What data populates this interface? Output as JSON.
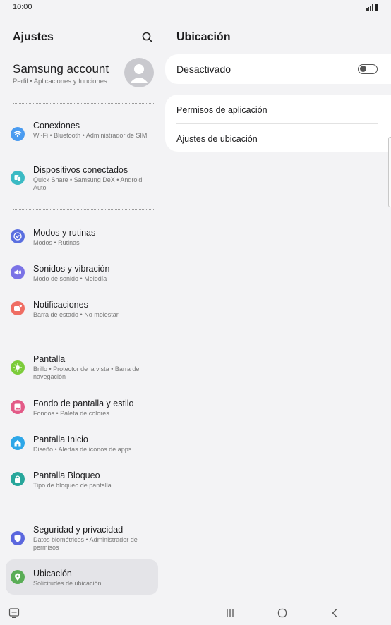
{
  "status": {
    "time": "10:00"
  },
  "left_panel": {
    "title": "Ajustes",
    "account": {
      "name": "Samsung account",
      "subtitle": "Perfil  •  Aplicaciones y funciones"
    },
    "items": [
      {
        "title": "Conexiones",
        "subtitle": "Wi-Fi  •  Bluetooth  •  Administrador de SIM",
        "icon": "wifi-icon",
        "color": "#4a9bf0"
      },
      {
        "title": "Dispositivos conectados",
        "subtitle": "Quick Share  •  Samsung DeX  •  Android Auto",
        "icon": "devices-icon",
        "color": "#3bbac4"
      },
      {
        "title": "Modos y rutinas",
        "subtitle": "Modos  •  Rutinas",
        "icon": "check-circle-icon",
        "color": "#5a6fe0"
      },
      {
        "title": "Sonidos y vibración",
        "subtitle": "Modo de sonido  •  Melodía",
        "icon": "speaker-icon",
        "color": "#7a72e6"
      },
      {
        "title": "Notificaciones",
        "subtitle": "Barra de estado  •  No molestar",
        "icon": "bell-icon",
        "color": "#ef6d63"
      },
      {
        "title": "Pantalla",
        "subtitle": "Brillo  •  Protector de la vista  •  Barra de navegación",
        "icon": "sun-icon",
        "color": "#7ccc3a"
      },
      {
        "title": "Fondo de pantalla y estilo",
        "subtitle": "Fondos  •  Paleta de colores",
        "icon": "image-icon",
        "color": "#e35a87"
      },
      {
        "title": "Pantalla Inicio",
        "subtitle": "Diseño  •  Alertas de iconos de apps",
        "icon": "home-icon",
        "color": "#2ea7e8"
      },
      {
        "title": "Pantalla Bloqueo",
        "subtitle": "Tipo de bloqueo de pantalla",
        "icon": "lock-icon",
        "color": "#27a69b"
      },
      {
        "title": "Seguridad y privacidad",
        "subtitle": "Datos biométricos  •  Administrador de permisos",
        "icon": "shield-icon",
        "color": "#5b67de"
      },
      {
        "title": "Ubicación",
        "subtitle": "Solicitudes de ubicación",
        "icon": "location-pin-icon",
        "color": "#5aad56"
      }
    ]
  },
  "right_panel": {
    "title": "Ubicación",
    "toggle": {
      "label": "Desactivado",
      "on": false
    },
    "options": [
      "Permisos de aplicación",
      "Ajustes de ubicación"
    ]
  },
  "colors": {
    "background": "#f3f3f5",
    "card": "#ffffff",
    "active_item": "#e4e4e8"
  }
}
